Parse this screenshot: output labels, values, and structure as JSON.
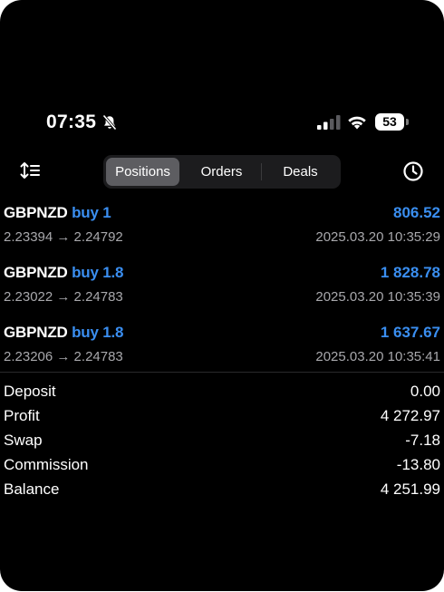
{
  "status_bar": {
    "time": "07:35",
    "battery": "53"
  },
  "tabs": {
    "positions": "Positions",
    "orders": "Orders",
    "deals": "Deals",
    "active": "Positions"
  },
  "icons": {
    "sort": "sort-icon",
    "history": "history-clock-icon",
    "bell": "bell-muted-icon",
    "signal": "cellular-signal-icon",
    "wifi": "wifi-icon"
  },
  "colors": {
    "accent": "#3a8ef0",
    "background": "#000000",
    "muted_text": "#a8a8ac"
  },
  "positions": [
    {
      "symbol": "GBPNZD",
      "side": "buy 1",
      "profit": "806.52",
      "prices": "2.23394 → 2.24792",
      "time": "2025.03.20 10:35:29"
    },
    {
      "symbol": "GBPNZD",
      "side": "buy 1.8",
      "profit": "1 828.78",
      "prices": "2.23022 → 2.24783",
      "time": "2025.03.20 10:35:39"
    },
    {
      "symbol": "GBPNZD",
      "side": "buy 1.8",
      "profit": "1 637.67",
      "prices": "2.23206 → 2.24783",
      "time": "2025.03.20 10:35:41"
    }
  ],
  "summary": {
    "deposit": {
      "label": "Deposit",
      "value": "0.00"
    },
    "profit": {
      "label": "Profit",
      "value": "4 272.97"
    },
    "swap": {
      "label": "Swap",
      "value": "-7.18"
    },
    "commission": {
      "label": "Commission",
      "value": "-13.80"
    },
    "balance": {
      "label": "Balance",
      "value": "4 251.99"
    }
  }
}
